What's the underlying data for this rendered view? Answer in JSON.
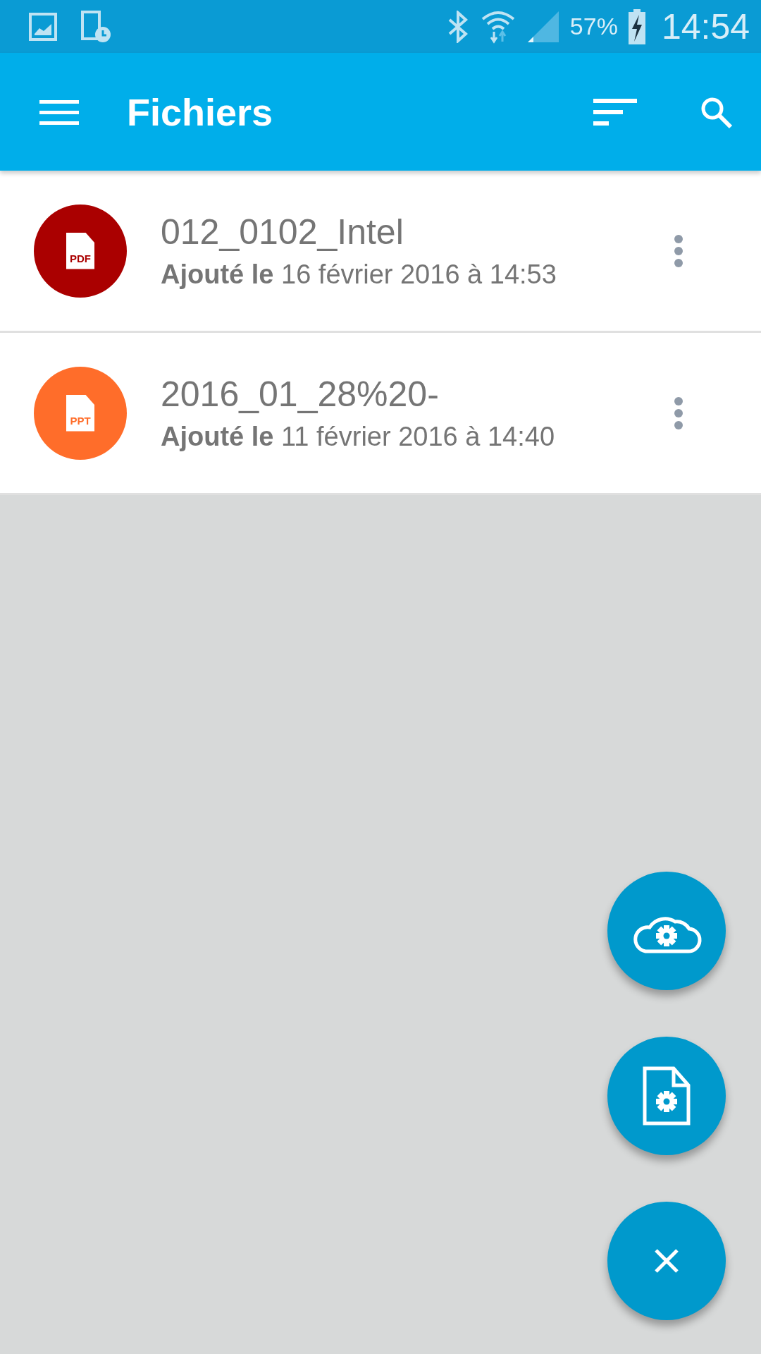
{
  "status_bar": {
    "battery": "57%",
    "time": "14:54"
  },
  "app_bar": {
    "title": "Fichiers"
  },
  "files": [
    {
      "name": "012_0102_Intel",
      "added": "**Ajouté le** 16 février 2016 à 14:53",
      "badge": "PDF",
      "color": "#aa0000"
    },
    {
      "name": "2016_01_28%20-",
      "added": "**Ajouté le** 11 février 2016 à 14:40",
      "badge": "PPT",
      "color": "#ff6d2a"
    }
  ],
  "fab_actions": [
    {
      "kind": "cloud"
    },
    {
      "kind": "document"
    },
    {
      "kind": "close"
    }
  ]
}
